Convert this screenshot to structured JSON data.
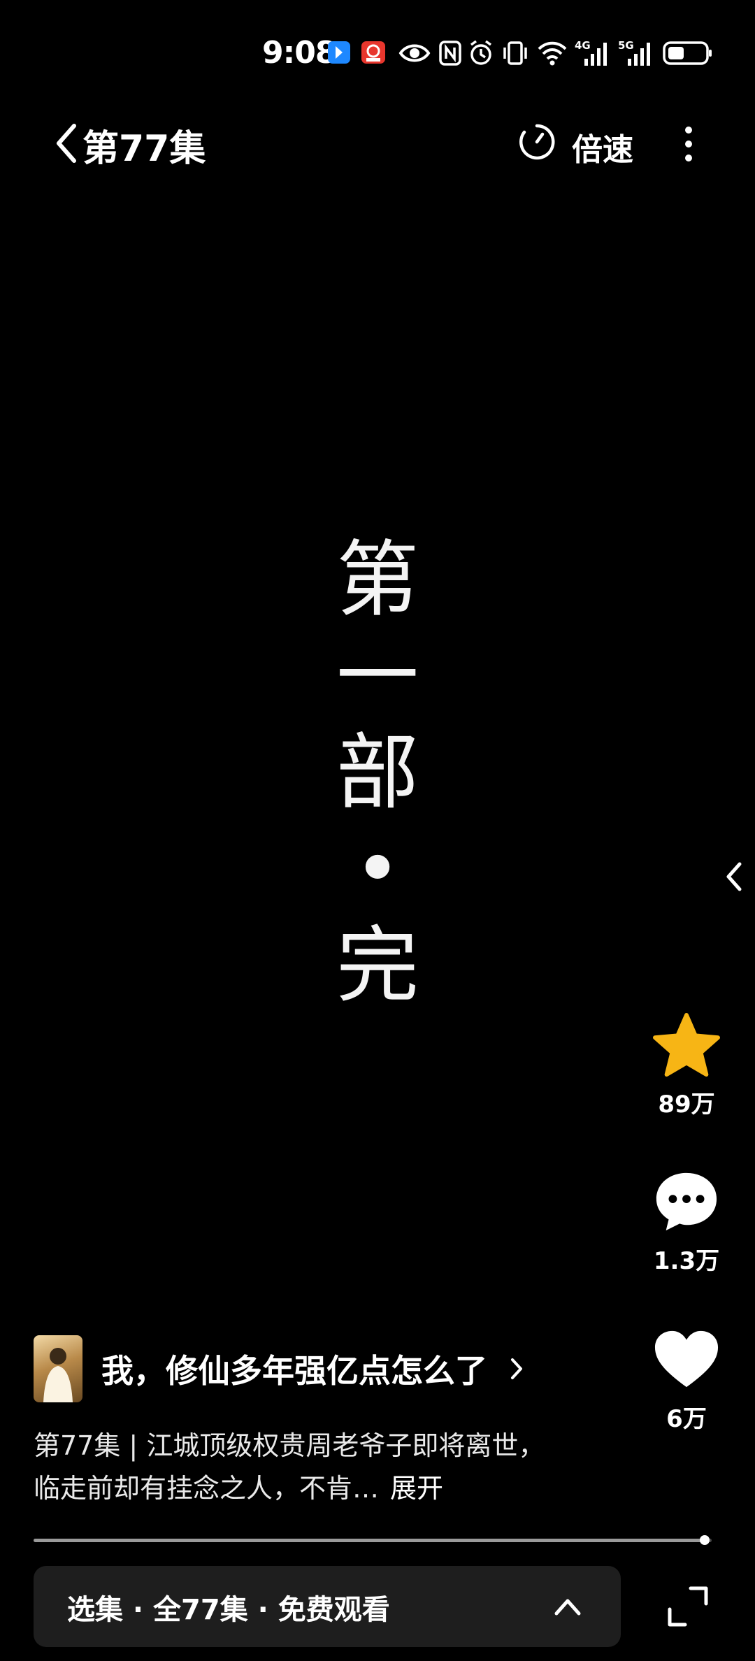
{
  "status_bar": {
    "time": "9:08",
    "icons": [
      "app-badge-blue",
      "app-badge-red",
      "eye-icon",
      "nfc-icon",
      "alarm-icon",
      "vibrate-icon",
      "wifi-icon",
      "4g-signal-icon",
      "5g-signal-icon",
      "battery-icon"
    ],
    "network_labels": [
      "4G",
      "5G"
    ]
  },
  "header": {
    "title": "第77集",
    "speed_label": "倍速"
  },
  "video": {
    "center_chars": [
      "第",
      "一",
      "部",
      "•",
      "完"
    ]
  },
  "actions": {
    "favorite_count": "89万",
    "comment_count": "1.3万",
    "like_count": "6万",
    "favorite_color": "#F7B515"
  },
  "drama": {
    "title": "我，修仙多年强亿点怎么了",
    "description": "第77集 | 江城顶级权贵周老爷子即将离世，临走前却有挂念之人，不肯…",
    "expand_label": "展开"
  },
  "progress": {
    "fraction": 0.99
  },
  "episode_bar": {
    "label": "选集 · 全77集 · 免费观看"
  }
}
